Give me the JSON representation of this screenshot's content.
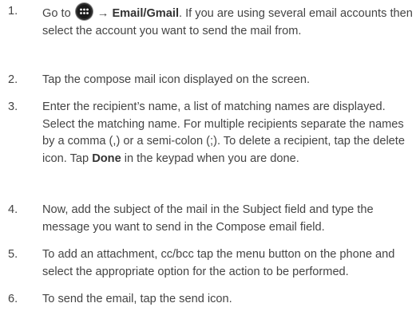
{
  "steps": [
    {
      "number": "1.",
      "pre": "Go to ",
      "icon": "apps-grid-icon",
      "arrow": " → ",
      "bold": "Email/Gmail",
      "post": ". If you are using several email accounts then select the account you want to send the mail from."
    },
    {
      "number": "2.",
      "text": "Tap the compose mail icon displayed on the screen."
    },
    {
      "number": "3.",
      "pre": "Enter the recipient’s name, a list of matching names are displayed. Select the matching name. For multiple recipients separate the names by a comma (,) or a semi-colon (;). To delete a recipient, tap the delete icon. Tap ",
      "bold": "Done",
      "post": " in the keypad when you are done."
    },
    {
      "number": "4.",
      "text": "Now, add the subject of the mail in the Subject field and type the message you want to send in the Compose email field."
    },
    {
      "number": "5.",
      "text": "To add an attachment, cc/bcc tap the menu button on the phone and select the appropriate option for the action to be performed."
    },
    {
      "number": "6.",
      "text": "To send the email, tap the send icon."
    }
  ]
}
